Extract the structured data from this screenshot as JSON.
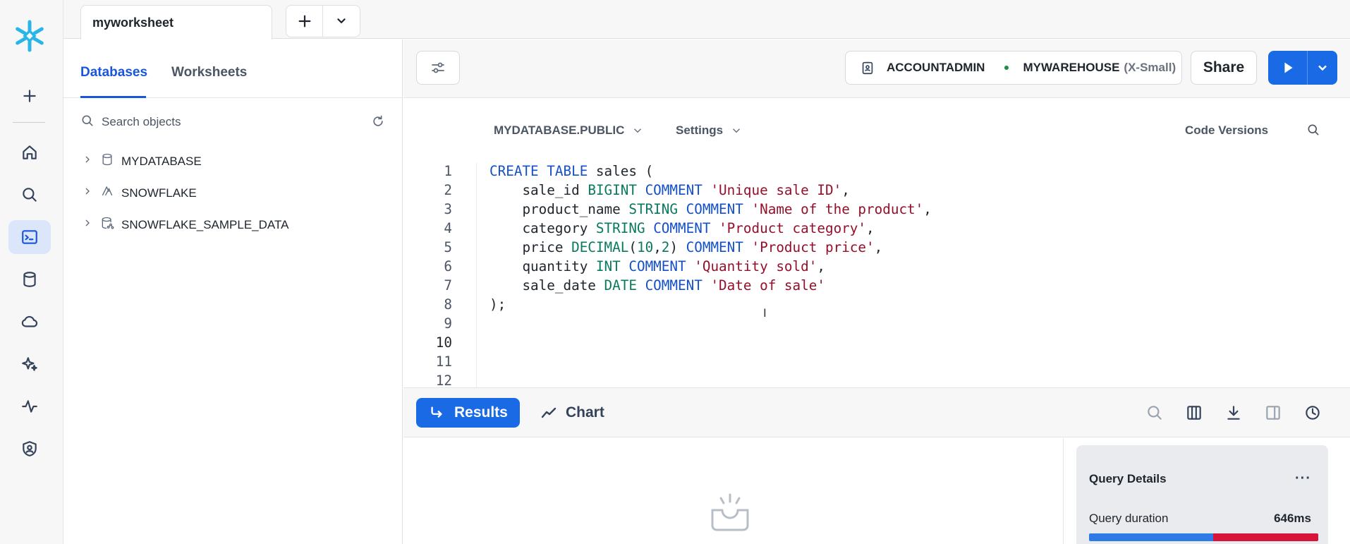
{
  "worksheet": {
    "tab_title": "myworksheet"
  },
  "browser": {
    "tabs": [
      {
        "label": "Databases"
      },
      {
        "label": "Worksheets"
      }
    ],
    "search_placeholder": "Search objects",
    "tree": [
      {
        "label": "MYDATABASE",
        "icon": "database-icon"
      },
      {
        "label": "SNOWFLAKE",
        "icon": "snowflake-db-icon"
      },
      {
        "label": "SNOWFLAKE_SAMPLE_DATA",
        "icon": "shared-database-icon"
      }
    ]
  },
  "context": {
    "role": "ACCOUNTADMIN",
    "warehouse": "MYWAREHOUSE",
    "warehouse_size": "(X-Small)"
  },
  "toolbar": {
    "share_label": "Share"
  },
  "editor": {
    "database_schema": "MYDATABASE.PUBLIC",
    "settings_label": "Settings",
    "code_versions_label": "Code Versions",
    "line_numbers": [
      "1",
      "2",
      "3",
      "4",
      "5",
      "6",
      "7",
      "8",
      "9",
      "10",
      "11",
      "12"
    ],
    "current_line": "10",
    "code_lines": [
      "CREATE TABLE sales (",
      "    sale_id BIGINT COMMENT 'Unique sale ID',",
      "    product_name STRING COMMENT 'Name of the product',",
      "    category STRING COMMENT 'Product category',",
      "    price DECIMAL(10,2) COMMENT 'Product price',",
      "    quantity INT COMMENT 'Quantity sold',",
      "    sale_date DATE COMMENT 'Date of sale'",
      ");",
      "",
      "",
      "",
      ""
    ]
  },
  "results": {
    "results_label": "Results",
    "chart_label": "Chart",
    "query_details": {
      "title": "Query Details",
      "more": "···",
      "duration_label": "Query duration",
      "duration_value": "646ms",
      "duration_split_fraction": 0.54
    }
  },
  "colors": {
    "accent": "#1a6ae6",
    "keyword": "#1450c8",
    "type": "#087a5e",
    "string": "#94102a",
    "brand": "#29b5e8"
  }
}
